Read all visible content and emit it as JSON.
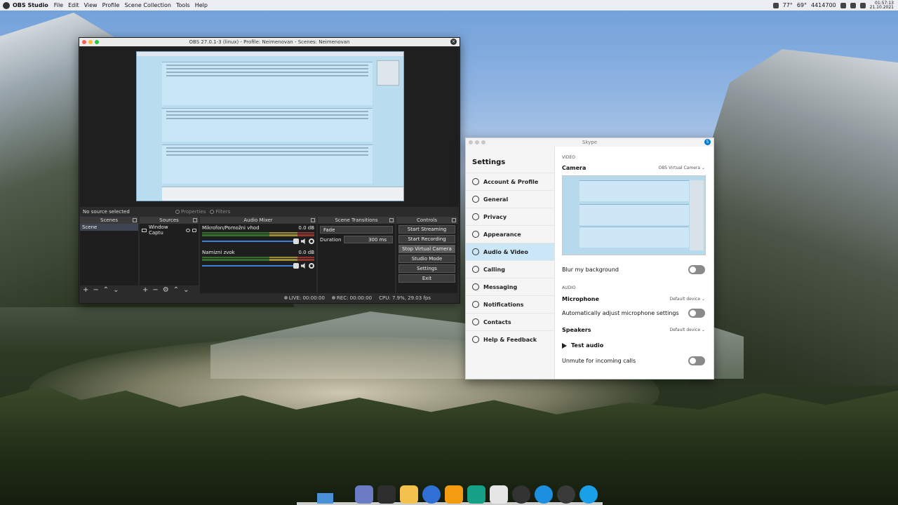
{
  "top_panel": {
    "app_name": "OBS Studio",
    "menus": [
      "File",
      "Edit",
      "View",
      "Profile",
      "Scene Collection",
      "Tools",
      "Help"
    ],
    "weather": "77°",
    "humidity": "69°",
    "network": "4414700",
    "clock_time": "01:57:13",
    "clock_date": "21.10.2021"
  },
  "obs": {
    "window_title": "OBS 27.0.1-3 (linux) - Profile: Neimenovan - Scenes: Neimenovan",
    "no_source": "No source selected",
    "properties_label": "Properties",
    "filters_label": "Filters",
    "docks": {
      "scenes": {
        "title": "Scenes",
        "items": [
          "Scene"
        ]
      },
      "sources": {
        "title": "Sources",
        "items": [
          "Window Captu"
        ]
      },
      "mixer": {
        "title": "Audio Mixer",
        "channels": [
          {
            "name": "Mikrofon/Pomožni vhod",
            "level": "0.0 dB"
          },
          {
            "name": "Namizni zvok",
            "level": "0.0 dB"
          }
        ]
      },
      "transitions": {
        "title": "Scene Transitions",
        "selected": "Fade",
        "duration_label": "Duration",
        "duration_value": "300 ms"
      },
      "controls": {
        "title": "Controls",
        "buttons": [
          "Start Streaming",
          "Start Recording",
          "Stop Virtual Camera",
          "Studio Mode",
          "Settings",
          "Exit"
        ]
      }
    },
    "status": {
      "live": "LIVE: 00:00:00",
      "rec": "REC: 00:00:00",
      "cpu": "CPU: 7.9%, 29.03 fps"
    }
  },
  "skype": {
    "window_title": "Skype",
    "settings_heading": "Settings",
    "nav": [
      {
        "label": "Account & Profile",
        "icon": "user-icon"
      },
      {
        "label": "General",
        "icon": "gear-icon"
      },
      {
        "label": "Privacy",
        "icon": "lock-icon"
      },
      {
        "label": "Appearance",
        "icon": "palette-icon"
      },
      {
        "label": "Audio & Video",
        "icon": "microphone-icon"
      },
      {
        "label": "Calling",
        "icon": "phone-icon"
      },
      {
        "label": "Messaging",
        "icon": "chat-icon"
      },
      {
        "label": "Notifications",
        "icon": "bell-icon"
      },
      {
        "label": "Contacts",
        "icon": "contacts-icon"
      },
      {
        "label": "Help & Feedback",
        "icon": "info-icon"
      }
    ],
    "active_nav": "Audio & Video",
    "video_section": "VIDEO",
    "camera_label": "Camera",
    "camera_value": "OBS Virtual Camera",
    "blur_label": "Blur my background",
    "audio_section": "AUDIO",
    "microphone_label": "Microphone",
    "microphone_value": "Default device",
    "auto_adjust_label": "Automatically adjust microphone settings",
    "speakers_label": "Speakers",
    "speakers_value": "Default device",
    "test_audio_label": "Test audio",
    "unmute_label": "Unmute for incoming calls"
  },
  "taskbar": {
    "apps": [
      "files-icon",
      "terminal-icon",
      "mail-icon",
      "firefox-icon",
      "sublime-icon",
      "notes-icon",
      "audio-player-icon",
      "gnome-logo-icon",
      "update-icon",
      "obs-icon",
      "skype-icon"
    ]
  }
}
